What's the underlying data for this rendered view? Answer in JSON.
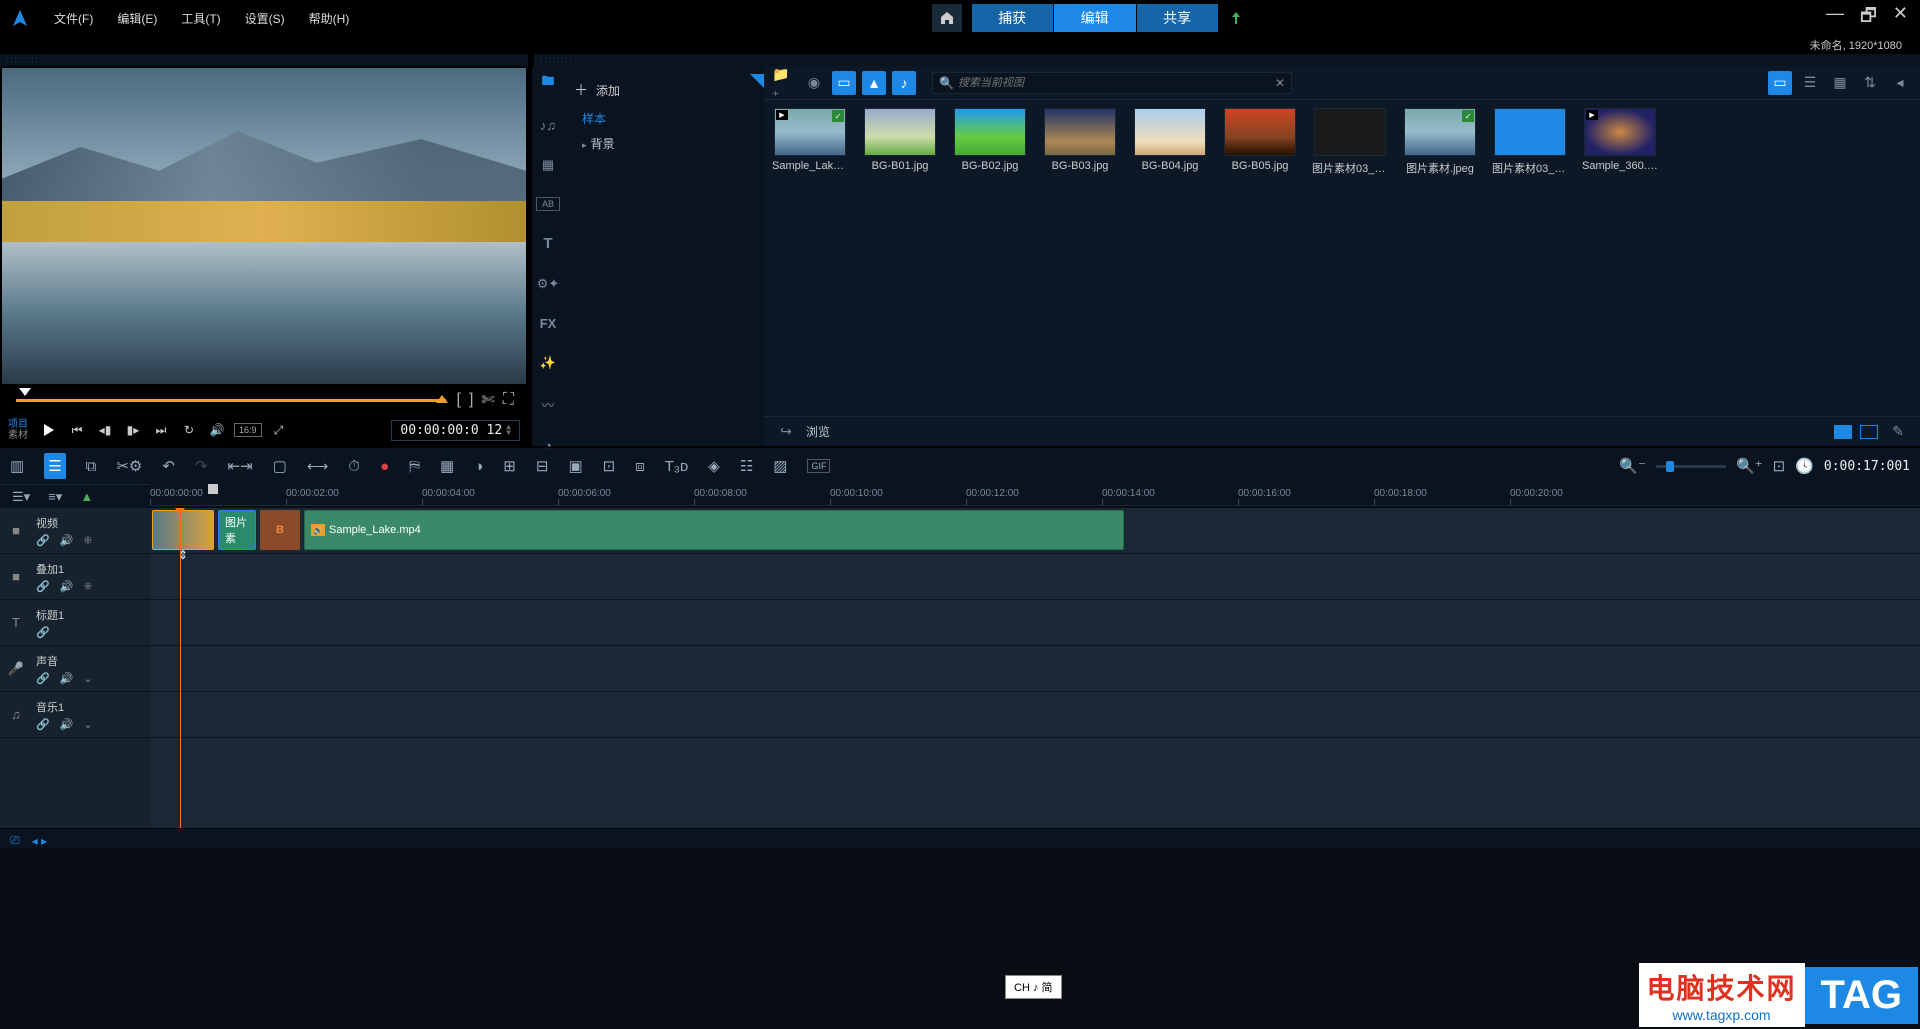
{
  "menu": {
    "file": "文件(F)",
    "edit": "编辑(E)",
    "tools": "工具(T)",
    "settings": "设置(S)",
    "help": "帮助(H)"
  },
  "project_info": "未命名, 1920*1080",
  "main_tabs": {
    "capture": "捕获",
    "edit": "编辑",
    "share": "共享"
  },
  "preview": {
    "mode_project": "项目",
    "mode_clip": "素材",
    "timecode": "00:00:00:0 12",
    "aspect": "16:9"
  },
  "library": {
    "add": "添加",
    "tree": {
      "sample": "样本",
      "background": "背景"
    },
    "search_placeholder": "搜索当前视图",
    "browse": "浏览",
    "thumbs": [
      {
        "label": "Sample_Lake...",
        "checked": true,
        "cam": true,
        "bg": "linear-gradient(to bottom,#7aa,#9bc 50%,#468)"
      },
      {
        "label": "BG-B01.jpg",
        "bg": "linear-gradient(to bottom,#9ac,#cda 60%,#6a4)"
      },
      {
        "label": "BG-B02.jpg",
        "bg": "linear-gradient(to bottom,#29e,#6c4 60%,#4a3)"
      },
      {
        "label": "BG-B03.jpg",
        "bg": "linear-gradient(to bottom,#236,#a85 70%,#764)"
      },
      {
        "label": "BG-B04.jpg",
        "bg": "linear-gradient(to bottom,#ace,#edb 70%,#ca7)"
      },
      {
        "label": "BG-B05.jpg",
        "bg": "linear-gradient(to bottom,#c42,#842 60%,#210)"
      },
      {
        "label": "图片素材03_副...",
        "bg": "#1a1a1a"
      },
      {
        "label": "图片素材.jpeg",
        "checked": true,
        "bg": "linear-gradient(to bottom,#7aa,#9bc 50%,#468)"
      },
      {
        "label": "图片素材03_副...",
        "bg": "#1e88e5"
      },
      {
        "label": "Sample_360.m...",
        "cam": true,
        "bg": "radial-gradient(ellipse at center,#c84 0%,#226 70%)"
      }
    ]
  },
  "timeline": {
    "timecode": "0:00:17:001",
    "ruler": [
      "00:00:00:00",
      "00:00:02:00",
      "00:00:04:00",
      "00:00:06:00",
      "00:00:08:00",
      "00:00:10:00",
      "00:00:12:00",
      "00:00:14:00",
      "00:00:16:00",
      "00:00:18:00",
      "00:00:20:00"
    ],
    "tracks": {
      "video": "视频",
      "overlay1": "叠加1",
      "title1": "标题1",
      "voice": "声音",
      "music1": "音乐1"
    },
    "clips": {
      "img2_label": "图片素",
      "video_label": "Sample_Lake.mp4"
    }
  },
  "ime": "CH ♪ 简",
  "watermark": {
    "cn": "电脑技术网",
    "url": "www.tagxp.com",
    "tag": "TAG"
  }
}
